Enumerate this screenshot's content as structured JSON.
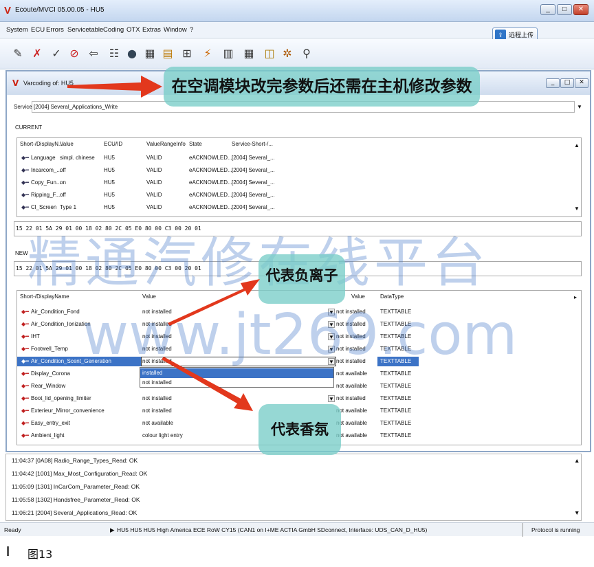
{
  "window": {
    "title": "Ecoute/MVCI 05.00.05 - HU5",
    "icon": "V",
    "minimize": "_",
    "maximize": "□",
    "close": "✕"
  },
  "menu": [
    "System",
    "ECU",
    "Errors",
    "Servicetable",
    "Coding",
    "OTX",
    "Extras",
    "Window",
    "?"
  ],
  "upload_button": "远程上传",
  "toolbar_icons": [
    "wrench-icon",
    "tools-icon",
    "check-icon",
    "no-entry-icon",
    "car-icon",
    "document-icon",
    "disc-icon",
    "grid-icon",
    "list-icon",
    "network-icon",
    "chart-icon",
    "table-icon",
    "calendar-icon",
    "compare-icon",
    "settings-icon",
    "binoculars-icon"
  ],
  "child_window": {
    "icon": "V",
    "title": "Varcoding of: HU5",
    "minimize": "_",
    "maximize": "□",
    "close": "✕"
  },
  "service": {
    "label": "Service",
    "value": "[2004] Several_Applications_Write"
  },
  "current": {
    "label": "CURRENT",
    "columns": [
      "Short-/DisplayN...",
      "Value",
      "ECU/ID",
      "ValueRangeInfo",
      "State",
      "Service-Short-/..."
    ],
    "rows": [
      [
        "Language",
        "simpl. chinese",
        "HU5",
        "VALID",
        "eACKNOWLED...",
        "[2004] Several_..."
      ],
      [
        "Incarcom_...",
        "off",
        "HU5",
        "VALID",
        "eACKNOWLED...",
        "[2004] Several_..."
      ],
      [
        "Copy_Fun...",
        "on",
        "HU5",
        "VALID",
        "eACKNOWLED...",
        "[2004] Several_..."
      ],
      [
        "Ripping_F...",
        "off",
        "HU5",
        "VALID",
        "eACKNOWLED...",
        "[2004] Several_..."
      ],
      [
        "Cl_Screen",
        "Type 1",
        "HU5",
        "VALID",
        "eACKNOWLED...",
        "[2004] Several_..."
      ]
    ],
    "hex": "15 22 01 5A 29 01 00 18 02 80 2C 05 E0 80 00 C3 00 20 01"
  },
  "new": {
    "label": "NEW",
    "hex": "15 22 01 5A 29 01 00 18 02 80 2C 05 E0 80 00 C3 00 20 01",
    "columns": [
      "Short-/DisplayName",
      "Value",
      "Value",
      "DataType"
    ],
    "rows": [
      [
        "Air_Condition_Fond",
        "not installed",
        "not installed",
        "TEXTTABLE"
      ],
      [
        "Air_Condition_Ionization",
        "not installed",
        "not installed",
        "TEXTTABLE"
      ],
      [
        "IHT",
        "not installed",
        "not installed",
        "TEXTTABLE"
      ],
      [
        "Footwell_Temp",
        "not installed",
        "not installed",
        "TEXTTABLE"
      ],
      [
        "Air_Condition_Scent_Generation",
        "not installed",
        "not installed",
        "TEXTTABLE"
      ],
      [
        "Display_Corona",
        "",
        "not available",
        "TEXTTABLE"
      ],
      [
        "Rear_Window",
        "",
        "not available",
        "TEXTTABLE"
      ],
      [
        "Boot_lid_opening_limiter",
        "not installed",
        "not installed",
        "TEXTTABLE"
      ],
      [
        "Exterieur_Mirror_convenience",
        "not installed",
        "not available",
        "TEXTTABLE"
      ],
      [
        "Easy_entry_exit",
        "not available",
        "not available",
        "TEXTTABLE"
      ],
      [
        "Ambient_light",
        "colour light entry",
        "not available",
        "TEXTTABLE"
      ]
    ],
    "dropdown_options": [
      "installed",
      "not installed"
    ]
  },
  "log": [
    "11:04:37 [0A08] Radio_Range_Types_Read: OK",
    "11:04:42 [1001] Max_Most_Configuration_Read: OK",
    "11:05:09 [1301] InCarCom_Parameter_Read: OK",
    "11:05:58 [1302] Handsfree_Parameter_Read: OK",
    "11:06:21 [2004] Several_Applications_Read: OK"
  ],
  "status": {
    "left": "Ready",
    "center": "HU5 HU5 HU5 High America ECE RoW CY15 (CAN1 on I+ME ACTIA GmbH SDconnect, Interface: UDS_CAN_D_HU5)",
    "right": "Protocol is running"
  },
  "annotations": {
    "top": "在空调模块改完参数后还需在主机修改参数",
    "negative_ion": "代表负离子",
    "fragrance": "代表香氛"
  },
  "watermark": {
    "cn": "精通汽修在线平台",
    "url": "www.jt269.com"
  },
  "caption": "图13",
  "colors": {
    "selection": "#3c73c6",
    "arrow": "#e2381d",
    "bubble": "#78cdc8",
    "watermark": "#4678c8"
  }
}
